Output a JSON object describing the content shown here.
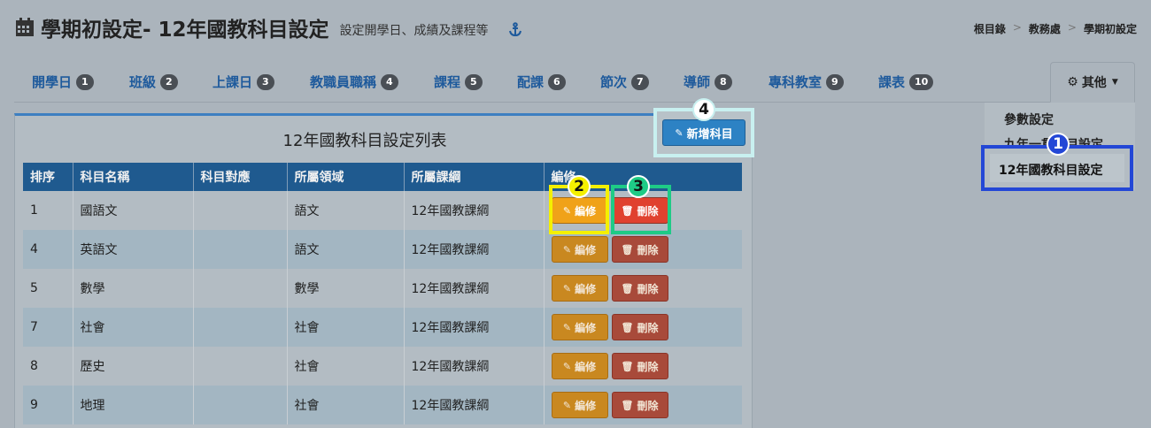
{
  "header": {
    "title": "學期初設定- 12年國教科目設定",
    "subtitle": "設定開學日、成績及課程等"
  },
  "breadcrumb": [
    "根目錄",
    "教務處",
    "學期初設定"
  ],
  "breadcrumb_sep": ">",
  "tabs": [
    {
      "label": "開學日",
      "badge": "1"
    },
    {
      "label": "班級",
      "badge": "2"
    },
    {
      "label": "上課日",
      "badge": "3"
    },
    {
      "label": "教職員職稱",
      "badge": "4"
    },
    {
      "label": "課程",
      "badge": "5"
    },
    {
      "label": "配課",
      "badge": "6"
    },
    {
      "label": "節次",
      "badge": "7"
    },
    {
      "label": "導師",
      "badge": "8"
    },
    {
      "label": "專科教室",
      "badge": "9"
    },
    {
      "label": "課表",
      "badge": "10"
    }
  ],
  "other_menu": {
    "label": "其他",
    "items": [
      "參數設定",
      "九年一貫科目設定",
      "12年國教科目設定"
    ]
  },
  "markers": {
    "m1": "1",
    "m2": "2",
    "m3": "3",
    "m4": "4"
  },
  "panel": {
    "title": "12年國教科目設定列表",
    "add_button": "新增科目"
  },
  "table": {
    "headers": [
      "排序",
      "科目名稱",
      "科目對應",
      "所屬領域",
      "所屬課綱",
      "編修"
    ],
    "edit_label": "編修",
    "delete_label": "刪除",
    "rows": [
      {
        "order": "1",
        "name": "國語文",
        "map": "",
        "domain": "語文",
        "curriculum": "12年國教課綱"
      },
      {
        "order": "4",
        "name": "英語文",
        "map": "",
        "domain": "語文",
        "curriculum": "12年國教課綱"
      },
      {
        "order": "5",
        "name": "數學",
        "map": "",
        "domain": "數學",
        "curriculum": "12年國教課綱"
      },
      {
        "order": "7",
        "name": "社會",
        "map": "",
        "domain": "社會",
        "curriculum": "12年國教課綱"
      },
      {
        "order": "8",
        "name": "歷史",
        "map": "",
        "domain": "社會",
        "curriculum": "12年國教課綱"
      },
      {
        "order": "9",
        "name": "地理",
        "map": "",
        "domain": "社會",
        "curriculum": "12年國教課綱"
      }
    ]
  },
  "colors": {
    "marker1": "#2347d6",
    "marker2": "#f4f000",
    "marker3": "#1ecb86",
    "marker4": "#c8f0f0"
  }
}
